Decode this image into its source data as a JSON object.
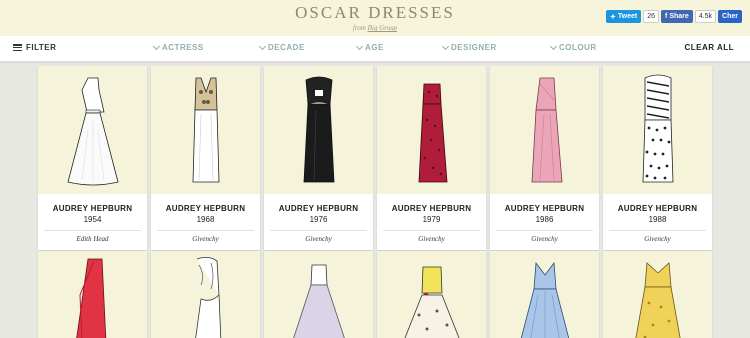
{
  "brand": {
    "title": "OSCAR DRESSES",
    "from": "from",
    "by": "Big Group"
  },
  "social": {
    "tweet": "Tweet",
    "tweet_count": "26",
    "share": "Share",
    "share_count": "4.5k",
    "cher": "Cher"
  },
  "filter": {
    "label": "FILTER",
    "items": [
      "ACTRESS",
      "DECADE",
      "AGE",
      "DESIGNER",
      "COLOUR"
    ],
    "clear": "CLEAR ALL"
  },
  "cards": [
    {
      "name": "AUDREY HEPBURN",
      "year": "1954",
      "designer": "Edith Head",
      "color": "#ffffff",
      "accent": "#e9e9e2",
      "icon": "dress-white-icon"
    },
    {
      "name": "AUDREY HEPBURN",
      "year": "1968",
      "designer": "Givenchy",
      "color": "#ffffff",
      "accent": "#b69a6a",
      "icon": "dress-beaded-icon"
    },
    {
      "name": "AUDREY HEPBURN",
      "year": "1976",
      "designer": "Givenchy",
      "color": "#1a1a1a",
      "accent": "#333333",
      "icon": "dress-black-icon"
    },
    {
      "name": "AUDREY HEPBURN",
      "year": "1979",
      "designer": "Givenchy",
      "color": "#b01d3a",
      "accent": "#6a0d20",
      "icon": "dress-red-icon"
    },
    {
      "name": "AUDREY HEPBURN",
      "year": "1986",
      "designer": "Givenchy",
      "color": "#e9a2b6",
      "accent": "#d47e98",
      "icon": "dress-pink-icon"
    },
    {
      "name": "AUDREY HEPBURN",
      "year": "1988",
      "designer": "Givenchy",
      "color": "#ffffff",
      "accent": "#222222",
      "icon": "dress-polka-icon"
    }
  ],
  "cards_row2": [
    {
      "color": "#e03445",
      "accent": "#b71f30",
      "icon": "dress-red-gown-icon"
    },
    {
      "color": "#ffffff",
      "accent": "#555555",
      "icon": "dress-ruffle-icon"
    },
    {
      "color": "#d9d4e8",
      "accent": "#b7b0cc",
      "icon": "dress-lilac-icon"
    },
    {
      "color": "#f3efe0",
      "accent": "#f1e45a",
      "icon": "dress-floral-icon"
    },
    {
      "color": "#a9c6e8",
      "accent": "#7aa2d1",
      "icon": "dress-blue-icon"
    },
    {
      "color": "#f0d25a",
      "accent": "#e1b82f",
      "icon": "dress-yellow-icon"
    }
  ]
}
